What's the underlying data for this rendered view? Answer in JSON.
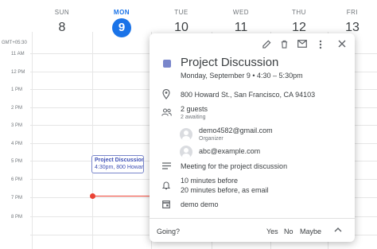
{
  "timezone": "GMT+05:30",
  "days": [
    {
      "name": "SUN",
      "num": "8"
    },
    {
      "name": "MON",
      "num": "9"
    },
    {
      "name": "TUE",
      "num": "10"
    },
    {
      "name": "WED",
      "num": "11"
    },
    {
      "name": "THU",
      "num": "12"
    },
    {
      "name": "FRI",
      "num": "13"
    }
  ],
  "hours": [
    "11 AM",
    "12 PM",
    "1 PM",
    "2 PM",
    "3 PM",
    "4 PM",
    "5 PM",
    "6 PM",
    "7 PM",
    "8 PM"
  ],
  "event_chip": {
    "title": "Project Discussion",
    "subtitle": "4:30pm, 800 Howard"
  },
  "popup": {
    "title": "Project Discussion",
    "date": "Monday, September 9  •  4:30 – 5:30pm",
    "location": "800 Howard St., San Francisco, CA 94103",
    "guests_count": "2 guests",
    "guests_awaiting": "2 awaiting",
    "guests": [
      {
        "email": "demo4582@gmail.com",
        "role": "Organizer"
      },
      {
        "email": "abc@example.com",
        "role": ""
      }
    ],
    "description": "Meeting for the project discussion",
    "reminders": [
      "10 minutes before",
      "20 minutes before, as email"
    ],
    "calendar": "demo demo",
    "going_label": "Going?",
    "rsvp": {
      "yes": "Yes",
      "no": "No",
      "maybe": "Maybe"
    }
  },
  "colors": {
    "accent": "#1a73e8",
    "event": "#7986cb",
    "now_line": "#ea4335"
  }
}
